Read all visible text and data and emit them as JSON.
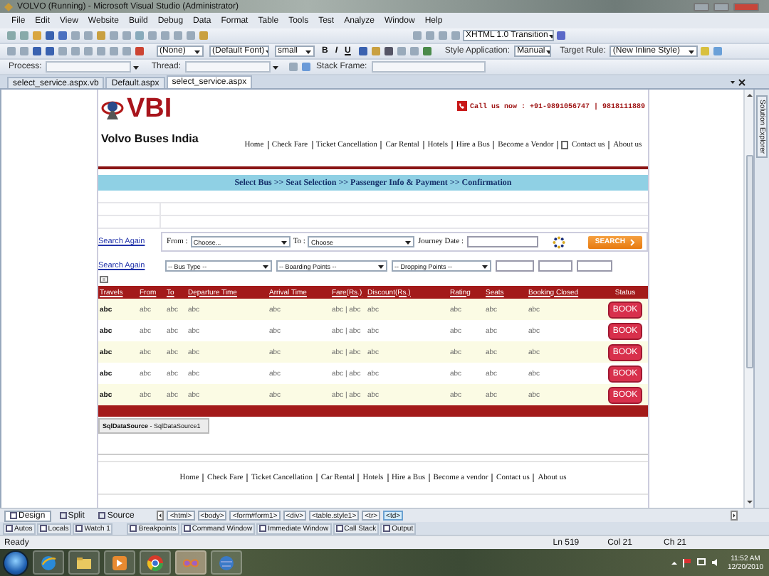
{
  "window": {
    "title": "VOLVO (Running) - Microsoft Visual Studio (Administrator)"
  },
  "menu": [
    "File",
    "Edit",
    "View",
    "Website",
    "Build",
    "Debug",
    "Data",
    "Format",
    "Table",
    "Tools",
    "Test",
    "Analyze",
    "Window",
    "Help"
  ],
  "toolbar": {
    "doctype": "XHTML 1.0 Transition",
    "block_format": "(None)",
    "font": "(Default Font)",
    "size": "small",
    "bold": "B",
    "italic": "I",
    "underline": "U",
    "style_application_label": "Style Application:",
    "style_application": "Manual",
    "target_rule_label": "Target Rule:",
    "target_rule": "(New Inline Style)"
  },
  "debug_toolbar": {
    "process_label": "Process:",
    "thread_label": "Thread:",
    "stack_frame_label": "Stack Frame:"
  },
  "doc_tabs": [
    {
      "label": "select_service.aspx.vb",
      "selected": false
    },
    {
      "label": "Default.aspx",
      "selected": false
    },
    {
      "label": "select_service.aspx",
      "selected": true
    }
  ],
  "page": {
    "logo_mark": "VBI",
    "logo_text": "Volvo Buses India",
    "call": "Call us now : +91-9891056747 | 9818111889",
    "nav": [
      "Home",
      "Check Fare",
      "Ticket Cancellation",
      "Car Rental",
      "Hotels",
      "Hire a Bus",
      "Become a Vendor",
      "Contact us",
      "About us"
    ],
    "steps": "Select Bus >> Seat Selection >> Passenger Info & Payment >> Confirmation",
    "search": {
      "link": "Search Again",
      "from_label": "From :",
      "from_value": "Choose...",
      "to_label": "To :",
      "to_value": "Choose",
      "date_label": "Journey Date :",
      "button": "SEARCH"
    },
    "filters": {
      "link": "Search Again",
      "bus_type": "-- Bus Type --",
      "boarding": "-- Boarding Points --",
      "dropping": "-- Dropping Points --"
    },
    "table": {
      "columns": [
        "Travels",
        "From",
        "To",
        "Departure Time",
        "Arrival Time",
        "Fare(Rs.)",
        "Discount(Rs.)",
        "Rating",
        "Seats",
        "Booking Closed",
        "Status"
      ],
      "rows": [
        {
          "cells": [
            "abc",
            "abc",
            "abc",
            "abc",
            "abc",
            "abc | abc",
            "abc",
            "abc",
            "abc",
            "abc"
          ],
          "action": "BOOK"
        },
        {
          "cells": [
            "abc",
            "abc",
            "abc",
            "abc",
            "abc",
            "abc | abc",
            "abc",
            "abc",
            "abc",
            "abc"
          ],
          "action": "BOOK"
        },
        {
          "cells": [
            "abc",
            "abc",
            "abc",
            "abc",
            "abc",
            "abc | abc",
            "abc",
            "abc",
            "abc",
            "abc"
          ],
          "action": "BOOK"
        },
        {
          "cells": [
            "abc",
            "abc",
            "abc",
            "abc",
            "abc",
            "abc | abc",
            "abc",
            "abc",
            "abc",
            "abc"
          ],
          "action": "BOOK"
        },
        {
          "cells": [
            "abc",
            "abc",
            "abc",
            "abc",
            "abc",
            "abc | abc",
            "abc",
            "abc",
            "abc",
            "abc"
          ],
          "action": "BOOK"
        }
      ]
    },
    "data_source": "**SqlDataSource** - SqlDataSource1",
    "footer_nav": [
      "Home",
      "Check Fare",
      "Ticket Cancellation",
      "Car Rental",
      "Hotels",
      "Hire a Bus",
      "Become a vendor",
      "Contact us",
      "About us"
    ]
  },
  "side_tab": "Solution Explorer",
  "view_tabs": [
    {
      "label": "Design",
      "selected": true
    },
    {
      "label": "Split",
      "selected": false
    },
    {
      "label": "Source",
      "selected": false
    }
  ],
  "tag_path": [
    {
      "label": "<html>",
      "selected": false
    },
    {
      "label": "<body>",
      "selected": false
    },
    {
      "label": "<form#form1>",
      "selected": false
    },
    {
      "label": "<div>",
      "selected": false
    },
    {
      "label": "<table.style1>",
      "selected": false
    },
    {
      "label": "<tr>",
      "selected": false
    },
    {
      "label": "<td>",
      "selected": true
    }
  ],
  "tool_windows": [
    "Autos",
    "Locals",
    "Watch 1",
    "Breakpoints",
    "Command Window",
    "Immediate Window",
    "Call Stack",
    "Output"
  ],
  "status_bar": {
    "message": "Ready",
    "line": "Ln 519",
    "col": "Col 21",
    "ch": "Ch 21"
  },
  "taskbar": {
    "time": "11:52 AM",
    "date": "12/20/2010"
  }
}
